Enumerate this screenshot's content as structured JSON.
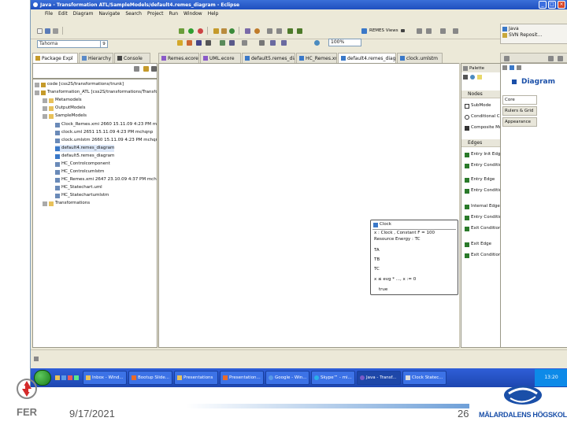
{
  "window": {
    "title": "Java - Transformation ATL/SampleModels/default4.remes_diagram - Eclipse",
    "controls": [
      "_",
      "□",
      "×"
    ]
  },
  "menu": [
    "File",
    "Edit",
    "Diagram",
    "Navigate",
    "Search",
    "Project",
    "Run",
    "Window",
    "Help"
  ],
  "toolbar": {
    "font": "Tahoma",
    "font_size": "9",
    "zoom": "100%",
    "remes_views": "REMES Views",
    "perspectives": [
      "Java",
      "SVN Reposit..."
    ]
  },
  "left_tabs": [
    "Package Expl",
    "Hierarchy",
    "Console"
  ],
  "editor_tabs": [
    "Remes.ecore",
    "UML.ecore",
    "default5.remes_diagr",
    "HC_Remes.xmi",
    "default4.remes_diagr",
    "clock.umlstm"
  ],
  "tree": [
    {
      "depth": 0,
      "label": "code  [css2S/transformations/trunk]"
    },
    {
      "depth": 0,
      "label": "Transformation_ATL [css2S/transformations/Transform"
    },
    {
      "depth": 1,
      "label": "Metamodels"
    },
    {
      "depth": 1,
      "label": "OutputModels"
    },
    {
      "depth": 1,
      "label": "SampleModels"
    },
    {
      "depth": 2,
      "label": "Clock_Remes.xmi 2660 15.11.09 4:23 PM  m"
    },
    {
      "depth": 2,
      "label": "clock.uml 2651 15.11.09 4:23 PM  mchqnp"
    },
    {
      "depth": 2,
      "label": "clock.umlstm 2660 15.11.09 4:23 PM  mchqnp"
    },
    {
      "depth": 2,
      "label": "default4.remes_diagram"
    },
    {
      "depth": 2,
      "label": "default5.remes_diagram"
    },
    {
      "depth": 2,
      "label": "HC_Controlcomponent"
    },
    {
      "depth": 2,
      "label": "HC_Controlcumlstm"
    },
    {
      "depth": 2,
      "label": "HC_Remes.xmi 2647 23.10.09 4:37 PM  mch"
    },
    {
      "depth": 2,
      "label": "HC_Statechart.uml"
    },
    {
      "depth": 2,
      "label": "HC_Statechartumlstm"
    },
    {
      "depth": 1,
      "label": "Transformations"
    }
  ],
  "diagram": {
    "state_name": "Clock",
    "lines": [
      "x : Clock , Constant F = 100",
      "Resource Energy : TC",
      "TA",
      "TB",
      "TC",
      "x ≤ evg * ..., x := 0",
      "true"
    ]
  },
  "palette": {
    "header": "Palette",
    "groups": [
      {
        "name": "Nodes",
        "items": [
          "SubMode",
          "Conditional Connector",
          "Composite Mode"
        ]
      },
      {
        "name": "Edges",
        "items": [
          "Entry Init Edge",
          "Entry Conditional Top L",
          "Entry Edge",
          "Entry Conditional Top L",
          "Internal Edge",
          "Entry Conditional Sub E",
          "Exit Conditional Sub Co",
          "Exit Edge",
          "Exit Conditional Top Ed"
        ]
      }
    ]
  },
  "properties": {
    "title": "Diagram",
    "tabs": [
      "Core",
      "Rulers & Grid",
      "Appearance"
    ]
  },
  "taskbar": {
    "items": [
      "Inbox - Wind...",
      "Bootup Slide...",
      "Presentations",
      "Presentation...",
      "Google - Win...",
      "Skype™ - mi...",
      "Java - Transf...",
      "Clock Statec..."
    ],
    "active_index": 6,
    "clock": "13:20"
  },
  "footer": {
    "date": "9/17/2021",
    "page": "26",
    "left_logo": "FER",
    "right_logo": "MÄLARDALENS HÖGSKOLA"
  },
  "colors": {
    "titlebar": "#1f4fbf",
    "taskbar": "#2f5fd8",
    "start": "#2e9e2e",
    "footer_text": "#555555",
    "mdh_blue": "#1a4fa8",
    "fer_red": "#d42a2a"
  }
}
